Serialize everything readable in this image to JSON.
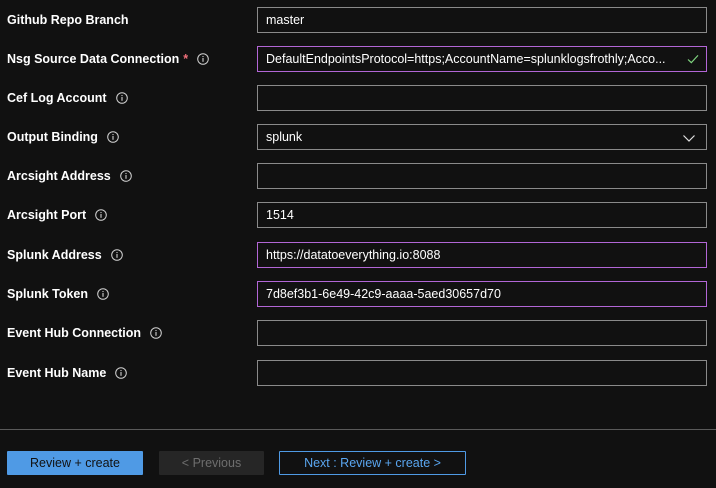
{
  "form": {
    "fields": [
      {
        "label": "Github Repo Branch",
        "value": "master",
        "placeholder": "",
        "required": false,
        "info": false
      },
      {
        "label": "Nsg Source Data Connection",
        "value": "DefaultEndpointsProtocol=https;AccountName=splunklogsfrothly;Acco...",
        "placeholder": "",
        "required": true,
        "info": true
      },
      {
        "label": "Cef Log Account",
        "value": "",
        "placeholder": "",
        "required": false,
        "info": true
      },
      {
        "label": "Output Binding",
        "value": "splunk",
        "required": false,
        "info": true
      },
      {
        "label": "Arcsight Address",
        "value": "",
        "placeholder": "",
        "required": false,
        "info": true
      },
      {
        "label": "Arcsight Port",
        "value": "1514",
        "placeholder": "",
        "required": false,
        "info": true
      },
      {
        "label": "Splunk Address",
        "value": "https://datatoeverything.io:8088",
        "placeholder": "",
        "required": false,
        "info": true
      },
      {
        "label": "Splunk Token",
        "value": "7d8ef3b1-6e49-42c9-aaaa-5aed30657d70",
        "placeholder": "",
        "required": false,
        "info": true
      },
      {
        "label": "Event Hub Connection",
        "value": "",
        "placeholder": "",
        "required": false,
        "info": true
      },
      {
        "label": "Event Hub Name",
        "value": "",
        "placeholder": "",
        "required": false,
        "info": true
      }
    ],
    "required_marker": "*"
  },
  "footer": {
    "review_create_label": "Review + create",
    "previous_label": "< Previous",
    "next_label": "Next : Review + create >"
  },
  "icons": {
    "info": "info-circle-icon",
    "check": "checkmark-icon",
    "chevron": "chevron-down-icon"
  },
  "colors": {
    "background": "#111111",
    "field_border": "#8a8a8a",
    "field_focus_border": "#b266d6",
    "required": "#f1707b",
    "valid_check": "#7fd47f",
    "primary": "#4f9ae5"
  }
}
